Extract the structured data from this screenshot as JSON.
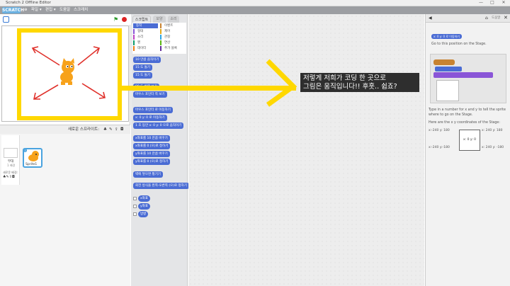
{
  "window": {
    "title": "Scratch 2 Offline Editor",
    "controls": [
      "—",
      "□",
      "✕"
    ]
  },
  "menu": {
    "logo": "SCRATCH",
    "items": [
      "파일 ▾",
      "편집 ▾",
      "도움말",
      "스크래치"
    ]
  },
  "stage": {
    "sprite_label": "Sprite1"
  },
  "sprite_pane": {
    "header": "새로운 스프라이트:",
    "stage_label": "무대",
    "stage_sub": "1 배경",
    "backdrop_label": "새로운 배경:",
    "sprite_name": "Sprite1"
  },
  "palette": {
    "tabs": [
      "스크립트",
      "모양",
      "소리"
    ],
    "categories": [
      "동작",
      "형태",
      "소리",
      "펜",
      "데이터",
      "이벤트",
      "제어",
      "관찰",
      "연산",
      "추가 블록"
    ],
    "blocks": [
      "10 만큼 움직이기",
      "15 도 돌기",
      "15 도 돌기",
      "90 도 방향 보기",
      "마우스 포인터 쪽 보기",
      "마우스 포인터 로 이동하기",
      "x: 0 y: 0 로 이동하기",
      "1 초 동안 x: 0 y: 0 으로 움직이기",
      "x좌표를 10 만큼 바꾸기",
      "x좌표를 0 (으)로 정하기",
      "y좌표를 10 만큼 바꾸기",
      "y좌표를 0 (으)로 정하기",
      "벽에 닿으면 튕기기",
      "회전 방식을 왼쪽-오른쪽 (으)로 정하기",
      "x좌표",
      "y좌표",
      "방향"
    ]
  },
  "annotation": {
    "line1": "저렇게 저희가 코딩 한 곳으로",
    "line2": "그림은 움직입니다!! 후훗.. 쉽죠?"
  },
  "tips": {
    "title": "도움말",
    "go_to": "Go to this position on the Stage.",
    "para1": "Type in a number for x and y to tell the sprite where to go on the Stage.",
    "para2": "Here are the x y coordinates of the Stage:",
    "center": "x: 0 y: 0",
    "coords": {
      "tl": "x:-240 y: 180",
      "tr": "x: 240 y: 180",
      "bl": "x:-240 y:-180",
      "br": "x: 240 y: -180"
    }
  },
  "colors": {
    "accent": "#ffd800",
    "motion": "#4a6cd4",
    "annotation_bg": "#2e2e2e"
  }
}
